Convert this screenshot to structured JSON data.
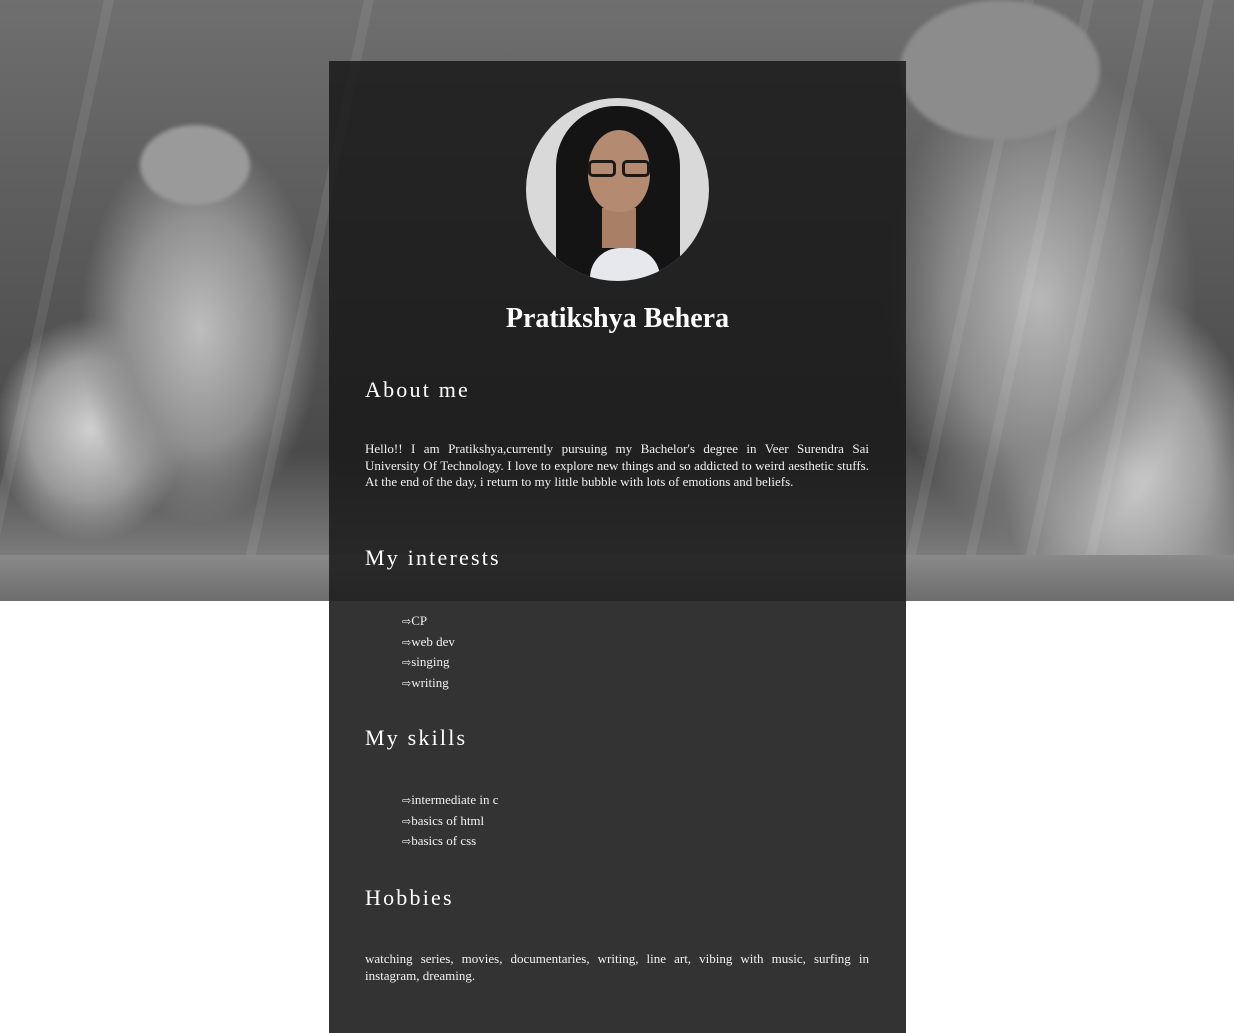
{
  "profile": {
    "name": "Pratikshya Behera",
    "photo": "profile-photo"
  },
  "about": {
    "title": "About me",
    "text": "Hello!! I am Pratikshya,currently pursuing my Bachelor's degree in Veer Surendra Sai University Of Technology. I love to explore new things and so addicted to weird aesthetic stuffs. At the end of the day, i return to my little bubble with lots of emotions and beliefs."
  },
  "interests": {
    "title": "My interests",
    "bullet": "⇨",
    "items": [
      "CP",
      "web dev",
      "singing",
      "writing"
    ]
  },
  "skills": {
    "title": "My skills",
    "bullet": "⇨",
    "items": [
      "intermediate in c",
      "basics of html",
      "basics of css"
    ]
  },
  "hobbies": {
    "title": "Hobbies",
    "text": "watching series, movies, documentaries, writing, line art, vibing with music, surfing in instagram, dreaming."
  },
  "colors": {
    "card": "#181818",
    "card_lower": "#333333",
    "text": "#ffffff"
  }
}
